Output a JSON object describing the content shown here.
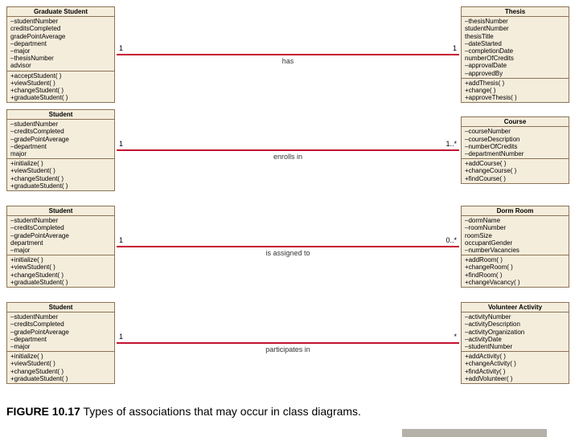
{
  "caption_bold": "FIGURE 10.17",
  "caption_rest": " Types of associations that may occur in class diagrams.",
  "rows": [
    {
      "left": {
        "name": "Graduate Student",
        "attrs": [
          "–studentNumber",
          "creditsCompleted",
          "gradePointAverage",
          "–department",
          "–major",
          "–thesisNumber",
          "advisor"
        ],
        "ops": [
          "+acceptStudent( )",
          "+viewStudent( )",
          "+changeStudent( )",
          "+graduateStudent( )"
        ]
      },
      "assoc": {
        "left_m": "1",
        "right_m": "1",
        "label": "has"
      },
      "right": {
        "name": "Thesis",
        "attrs": [
          "–thesisNumber",
          "studentNumber",
          "thesisTitle",
          "–dateStarted",
          "–completionDate",
          "numberOfCredits",
          "–approvalDate",
          "–approvedBy"
        ],
        "ops": [
          "+addThesis( )",
          "+change( )",
          "+approveThesis( )"
        ]
      }
    },
    {
      "left": {
        "name": "Student",
        "attrs": [
          "–studentNumber",
          "–creditsCompleted",
          "–gradePointAverage",
          "–department",
          "major"
        ],
        "ops": [
          "+initialize( )",
          "+viewStudent( )",
          "+changeStudent( )",
          "+graduateStudent( )"
        ]
      },
      "assoc": {
        "left_m": "1",
        "right_m": "1..*",
        "label": "enrolls in"
      },
      "right": {
        "name": "Course",
        "attrs": [
          "–courseNumber",
          "–courseDescription",
          "–numberOfCredits",
          "–departmentNumber"
        ],
        "ops": [
          "+addCourse( )",
          "+changeCourse( )",
          "+findCourse( )"
        ]
      }
    },
    {
      "left": {
        "name": "Student",
        "attrs": [
          "–studentNumber",
          "–creditsCompleted",
          "–gradePointAverage",
          "department",
          "–major"
        ],
        "ops": [
          "+initialize( )",
          "+viewStudent( )",
          "+changeStudent( )",
          "+graduateStudent( )"
        ]
      },
      "assoc": {
        "left_m": "1",
        "right_m": "0..*",
        "label": "is assigned to"
      },
      "right": {
        "name": "Dorm Room",
        "attrs": [
          "–dormName",
          "–roomNumber",
          "roomSize",
          "occupantGender",
          "–numberVacancies"
        ],
        "ops": [
          "+addRoom( )",
          "+changeRoom( )",
          "+findRoom( )",
          "+changeVacancy( )"
        ]
      }
    },
    {
      "left": {
        "name": "Student",
        "attrs": [
          "–studentNumber",
          "–creditsCompleted",
          "–gradePointAverage",
          "–department",
          "–major"
        ],
        "ops": [
          "+initialize( )",
          "+viewStudent( )",
          "+changeStudent( )",
          "+graduateStudent( )"
        ]
      },
      "assoc": {
        "left_m": "1",
        "right_m": "*",
        "label": "participates in"
      },
      "right": {
        "name": "Volunteer Activity",
        "attrs": [
          "–activityNumber",
          "–activityDescription",
          "–activityOrganization",
          "–activityDate",
          "–studentNumber"
        ],
        "ops": [
          "+addActivity( )",
          "+changeActivity( )",
          "+findActivity( )",
          "+addVolunteer( )"
        ]
      }
    }
  ]
}
